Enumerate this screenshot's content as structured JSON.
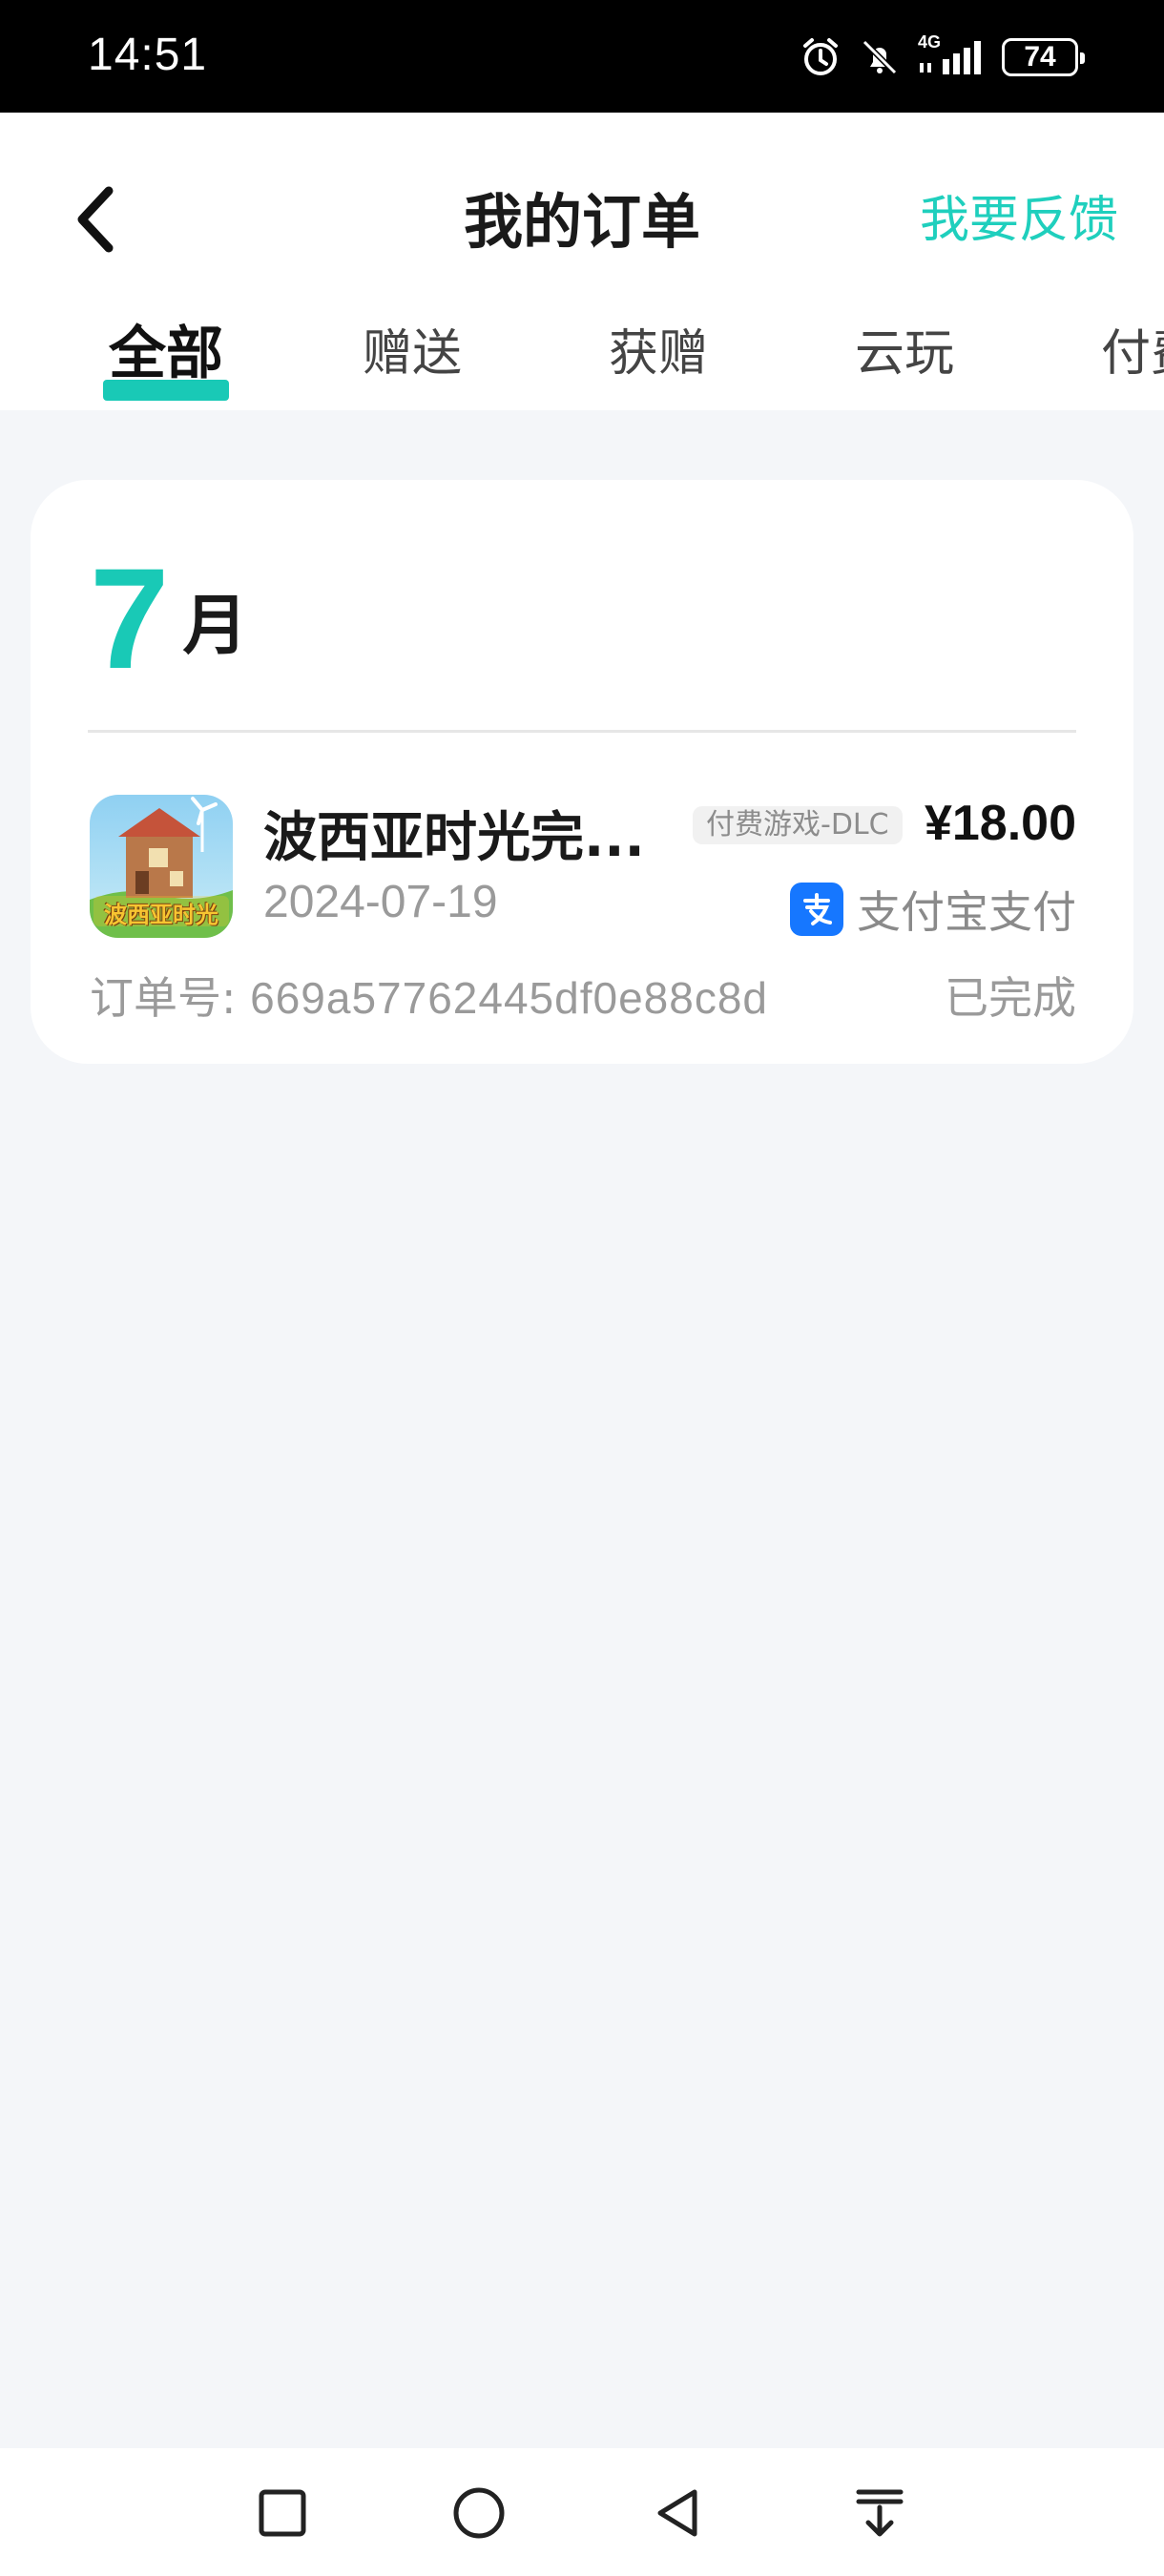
{
  "status_bar": {
    "time": "14:51",
    "network": "4G",
    "battery": "74"
  },
  "header": {
    "title": "我的订单",
    "feedback_label": "我要反馈",
    "back_icon": "chevron-left-icon"
  },
  "tabs": [
    {
      "label": "全部",
      "active": true
    },
    {
      "label": "赠送",
      "active": false
    },
    {
      "label": "获赠",
      "active": false
    },
    {
      "label": "云玩",
      "active": false
    },
    {
      "label": "付费",
      "active": false
    }
  ],
  "orders_group": {
    "month_number": "7",
    "month_unit": "月",
    "items": [
      {
        "title": "波西亚时光完...",
        "tag": "付费游戏-DLC",
        "price": "¥18.00",
        "date": "2024-07-19",
        "payment_method": "支付宝支付",
        "payment_icon": "alipay-icon",
        "order_number_label": "订单号:",
        "order_number": "669a57762445df0e88c8d",
        "status": "已完成",
        "icon_text": "波西亚时光"
      }
    ]
  },
  "colors": {
    "accent": "#19c9b6",
    "feedback": "#1fcfbd",
    "alipay": "#1677ff",
    "background": "#f4f6f9"
  },
  "nav_bar": {
    "buttons": [
      "recent-apps-icon",
      "home-icon",
      "back-icon",
      "menu-down-icon"
    ]
  }
}
